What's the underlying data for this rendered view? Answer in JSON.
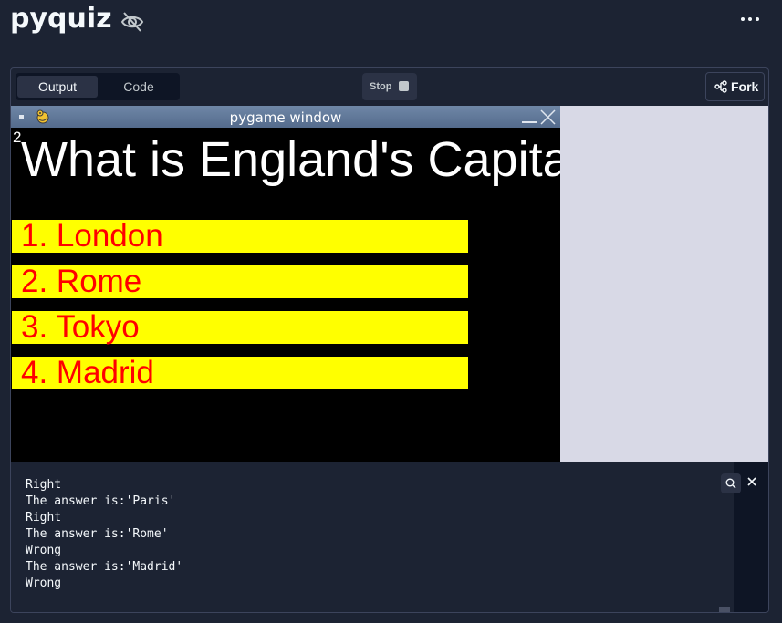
{
  "repl": {
    "title": "pyquiz"
  },
  "toolbar": {
    "tabs": [
      {
        "label": "Output"
      },
      {
        "label": "Code"
      }
    ],
    "stop_label": "Stop",
    "fork_label": "Fork"
  },
  "pygame": {
    "window_title": "pygame window",
    "counter": "2",
    "question": "What is England's Capital?",
    "answers": [
      {
        "label": "1. London"
      },
      {
        "label": "2. Rome"
      },
      {
        "label": "3. Tokyo"
      },
      {
        "label": "4. Madrid"
      }
    ],
    "colors": {
      "answer_bg": "#ffff00",
      "answer_text": "#ff0000",
      "canvas_bg": "#000000"
    }
  },
  "console": {
    "lines": [
      "Right",
      "The answer is:'Paris'",
      "Right",
      "The answer is:'Rome'",
      "Wrong",
      "The answer is:'Madrid'",
      "Wrong"
    ]
  }
}
